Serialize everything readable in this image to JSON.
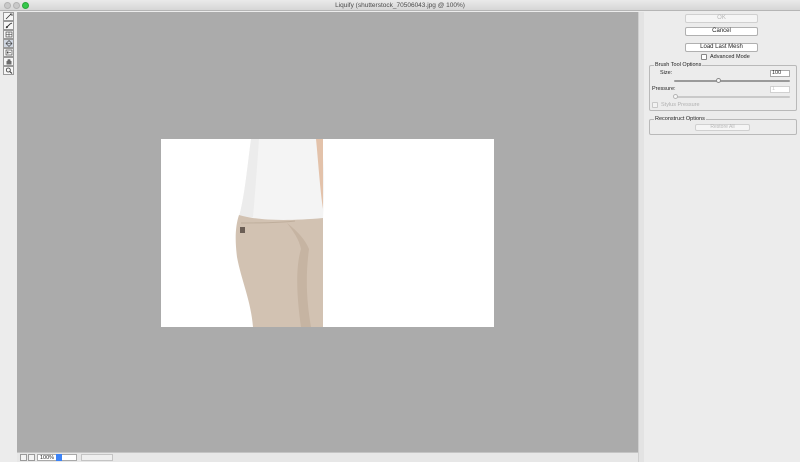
{
  "window": {
    "title": "Liquify (shutterstock_70506043.jpg @ 100%)"
  },
  "tools": [
    {
      "icon": "forward-warp-icon"
    },
    {
      "icon": "reconstruct-icon"
    },
    {
      "icon": "pucker-icon"
    },
    {
      "icon": "bloat-icon"
    },
    {
      "icon": "push-left-icon"
    },
    {
      "icon": "hand-icon"
    },
    {
      "icon": "zoom-icon"
    }
  ],
  "statusbar": {
    "zoom": "100%"
  },
  "panel": {
    "ok_label": "OK",
    "cancel_label": "Cancel",
    "load_last_mesh_label": "Load Last Mesh",
    "advanced_mode_label": "Advanced Mode",
    "advanced_mode_checked": false,
    "brush_group_title": "Brush Tool Options",
    "size_label": "Size:",
    "size_value": "100",
    "size_level": 0.38,
    "pressure_label": "Pressure:",
    "pressure_value": "1",
    "pressure_level": 0.01,
    "stylus_label": "Stylus Pressure",
    "reconstruct_group_title": "Reconstruct Options",
    "restore_all_label": "Restore All"
  },
  "colors": {
    "canvas": "#ababab",
    "image_background": "#ffffff",
    "shirt": "#f4f4f4",
    "pants": "#d2c2b2",
    "skin": "#e3c2aa",
    "zoom_accent": "#3b82f6",
    "maximize": "#34c84a"
  }
}
